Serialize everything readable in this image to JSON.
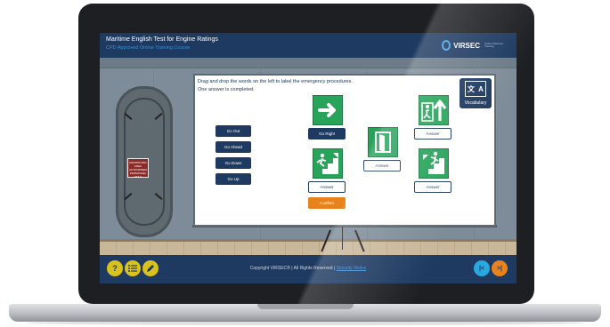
{
  "header": {
    "title": "Maritime English Test for Engine Ratings",
    "subtitle": "CPD Approved Online Training Course",
    "logo_text": "VIRSEC",
    "logo_tag": "Online Maritime Training"
  },
  "wall_sign": {
    "text": "RESTRICTED AREA AUTHORISED PERSONNEL ONLY"
  },
  "activity": {
    "instruction_line1": "Drag and drop the words on the left to label the emergency procedures.",
    "instruction_line2": "One answer is completed.",
    "vocabulary": {
      "label": "Vocabulary",
      "book_left": "文",
      "book_right": "A"
    },
    "words": [
      "Go Out",
      "Go Ahead",
      "Go Down",
      "Go Up"
    ],
    "answers": {
      "arrow_right": "Go Right",
      "stairs_down": "Answer",
      "exit_door": "Answer",
      "running_up": "Answer",
      "stairs_up": "Answer"
    },
    "confirm_label": "Confirm"
  },
  "footer": {
    "copyright": "Copyright VIRSEC® | All Rights Reserved |",
    "security_link": "Security Notice",
    "help_icon": "?",
    "prev_label": "|<",
    "next_label": ">|"
  },
  "colors": {
    "navy": "#1e3a61",
    "green": "#27a35a",
    "orange": "#e8821c",
    "yellow": "#d9c21b",
    "blue": "#2aa8e0"
  }
}
